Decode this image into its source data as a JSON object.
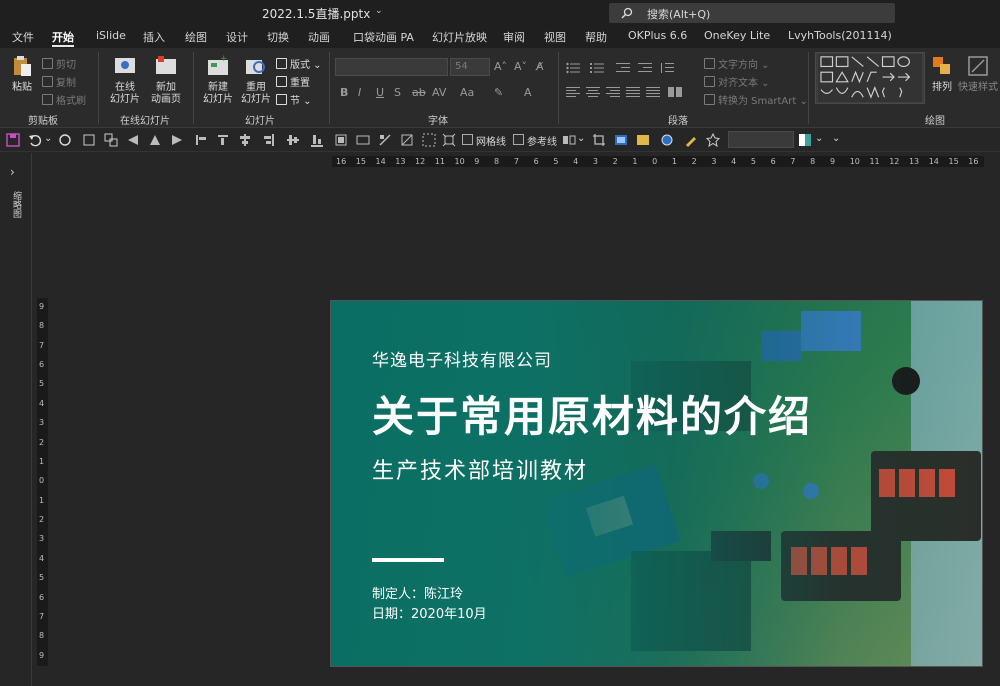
{
  "window": {
    "doc_title": "2022.1.5直播.pptx",
    "search_placeholder": "搜索(Alt+Q)"
  },
  "tabs": [
    {
      "label": "文件"
    },
    {
      "label": "开始",
      "active": true
    },
    {
      "label": "iSlide"
    },
    {
      "label": "插入"
    },
    {
      "label": "绘图"
    },
    {
      "label": "设计"
    },
    {
      "label": "切换"
    },
    {
      "label": "动画"
    },
    {
      "label": "口袋动画 PA"
    },
    {
      "label": "幻灯片放映"
    },
    {
      "label": "审阅"
    },
    {
      "label": "视图"
    },
    {
      "label": "帮助"
    },
    {
      "label": "OKPlus 6.6"
    },
    {
      "label": "OneKey Lite"
    },
    {
      "label": "LvyhTools(201114)"
    }
  ],
  "ribbon": {
    "clipboard": {
      "paste": "粘贴",
      "cut": "剪切",
      "copy": "复制",
      "format_painter": "格式刷",
      "label": "剪贴板"
    },
    "online": {
      "online_slides": "在线\n幻灯片",
      "new_anim": "新加\n动画页",
      "label": "在线幻灯片"
    },
    "slides": {
      "new_slide": "新建\n幻灯片",
      "reuse": "重用\n幻灯片",
      "layout": "版式",
      "reset": "重置",
      "section": "节",
      "label": "幻灯片"
    },
    "font": {
      "size": "54",
      "label": "字体"
    },
    "paragraph": {
      "text_direction": "文字方向",
      "align_text": "对齐文本",
      "smartart": "转换为 SmartArt",
      "label": "段落"
    },
    "drawing": {
      "arrange": "排列",
      "quick_styles": "快速样式",
      "label": "绘图"
    }
  },
  "qat": {
    "gridlines": "网格线",
    "guides": "参考线"
  },
  "left_pane": {
    "label": "缩略图"
  },
  "rulers": {
    "h": [
      "16",
      "15",
      "14",
      "13",
      "12",
      "11",
      "10",
      "9",
      "8",
      "7",
      "6",
      "5",
      "4",
      "3",
      "2",
      "1",
      "0",
      "1",
      "2",
      "3",
      "4",
      "5",
      "6",
      "7",
      "8",
      "9",
      "10",
      "11",
      "12",
      "13",
      "14",
      "15",
      "16"
    ],
    "v": [
      "9",
      "8",
      "7",
      "6",
      "5",
      "4",
      "3",
      "2",
      "1",
      "0",
      "1",
      "2",
      "3",
      "4",
      "5",
      "6",
      "7",
      "8",
      "9"
    ]
  },
  "slide": {
    "company": "华逸电子科技有限公司",
    "title": "关于常用原材料的介绍",
    "subtitle": "生产技术部培训教材",
    "maker": "制定人：陈江玲",
    "date": "日期：2020年10月"
  },
  "colors": {
    "slide_teal": "#0a6e64",
    "accent": "#e07a1f"
  }
}
